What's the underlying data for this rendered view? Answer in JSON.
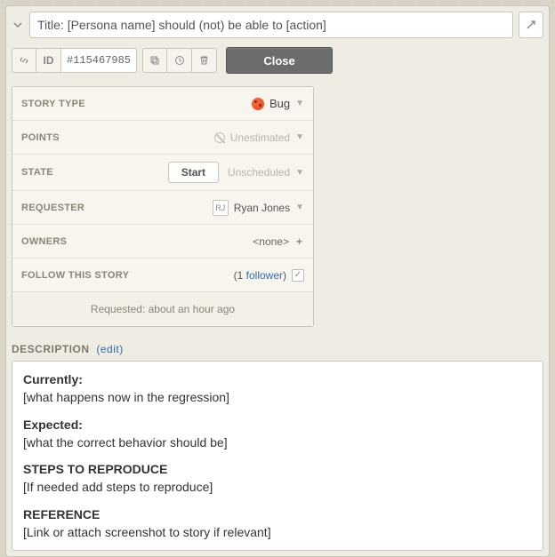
{
  "title": {
    "value": "Title: [Persona name] should (not) be able to [action]"
  },
  "toolbar": {
    "id_label": "ID",
    "id_value": "#115467985",
    "close_label": "Close"
  },
  "details": {
    "story_type": {
      "label": "STORY TYPE",
      "value": "Bug"
    },
    "points": {
      "label": "POINTS",
      "value": "Unestimated"
    },
    "state": {
      "label": "STATE",
      "button": "Start",
      "value": "Unscheduled"
    },
    "requester": {
      "label": "REQUESTER",
      "initials": "RJ",
      "value": "Ryan Jones"
    },
    "owners": {
      "label": "OWNERS",
      "value": "<none>"
    },
    "follow": {
      "label": "FOLLOW THIS STORY",
      "count_prefix": "(",
      "count": "1",
      "link": "follower",
      "count_suffix": ")"
    },
    "footer": "Requested: about an hour ago"
  },
  "description": {
    "heading": "DESCRIPTION",
    "edit": "(edit)",
    "sections": {
      "currently_h": "Currently:",
      "currently_b": "[what happens now in the regression]",
      "expected_h": "Expected:",
      "expected_b": "[what the correct behavior should be]",
      "steps_h": "STEPS TO REPRODUCE",
      "steps_b": "[If needed add steps to reproduce]",
      "reference_h": "REFERENCE",
      "reference_b": "[Link or attach screenshot to story if relevant]"
    }
  }
}
